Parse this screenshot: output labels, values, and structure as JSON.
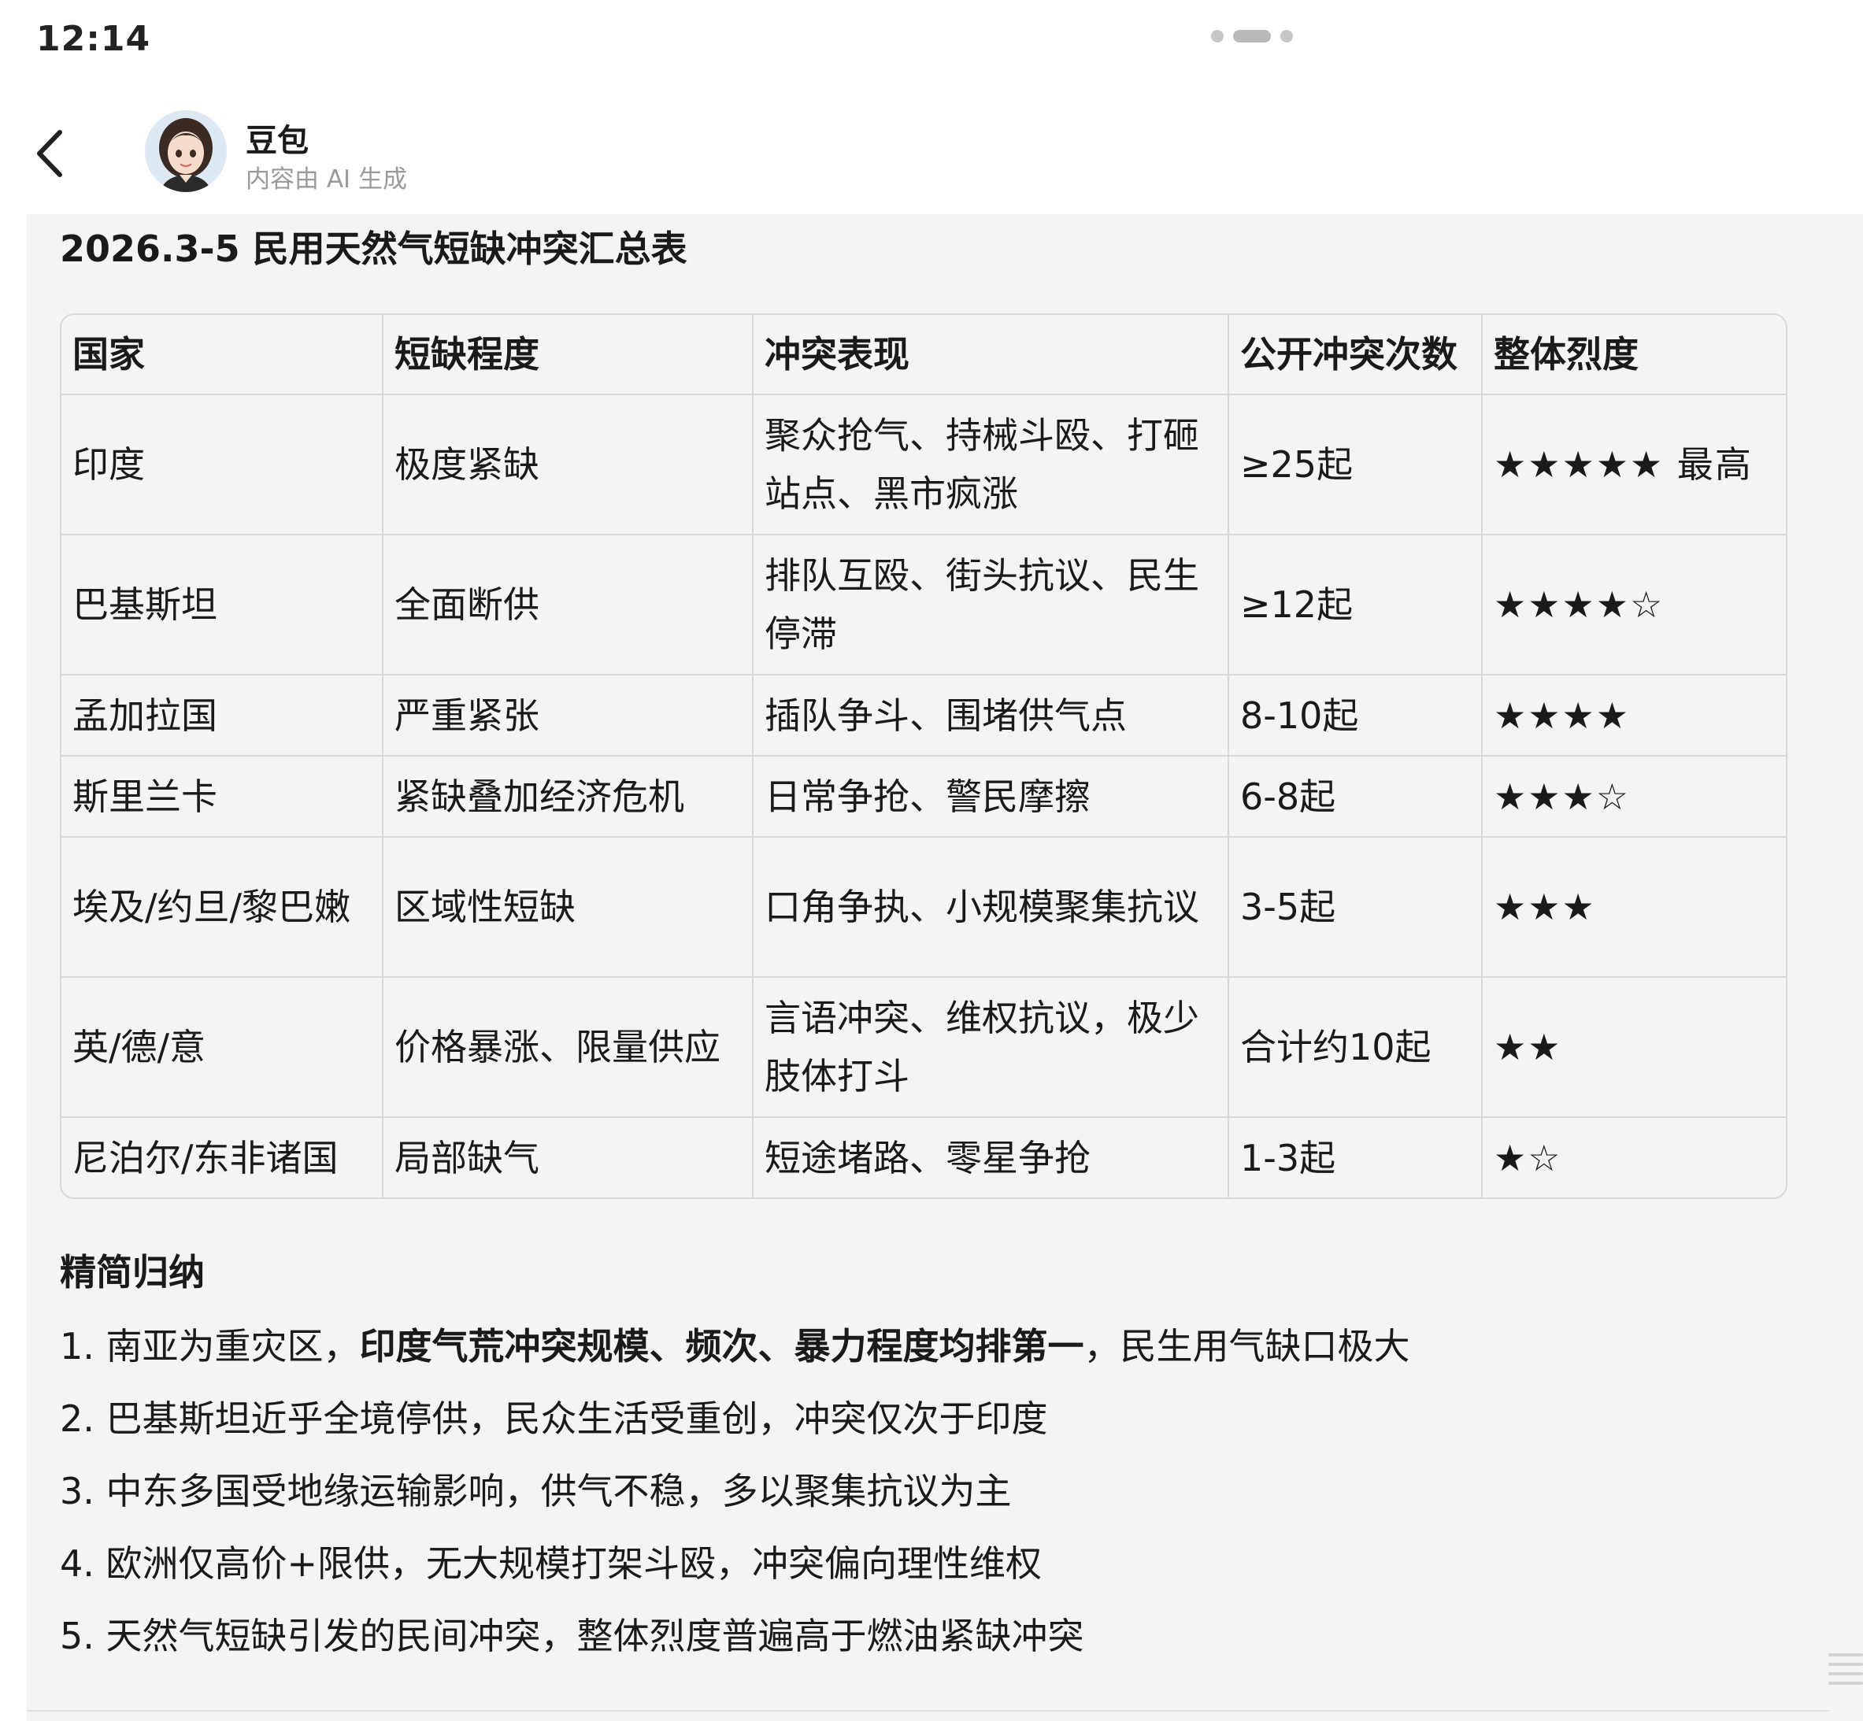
{
  "status_bar": {
    "time": "12:14"
  },
  "header": {
    "bot_name": "豆包",
    "subtitle": "内容由 AI 生成"
  },
  "table_title": "2026.3-5 民用天然气短缺冲突汇总表",
  "table": {
    "headers": [
      "国家",
      "短缺程度",
      "冲突表现",
      "公开冲突次数",
      "整体烈度"
    ],
    "rows": [
      {
        "country": "印度",
        "severity": "极度紧缺",
        "behavior": "聚众抢气、持械斗殴、打砸站点、黑市疯涨",
        "count": "≥25起",
        "intensity": "★★★★★ 最高"
      },
      {
        "country": "巴基斯坦",
        "severity": "全面断供",
        "behavior": "排队互殴、街头抗议、民生停滞",
        "count": "≥12起",
        "intensity": "★★★★☆"
      },
      {
        "country": "孟加拉国",
        "severity": "严重紧张",
        "behavior": "插队争斗、围堵供气点",
        "count": "8-10起",
        "intensity": "★★★★"
      },
      {
        "country": "斯里兰卡",
        "severity": "紧缺叠加经济危机",
        "behavior": "日常争抢、警民摩擦",
        "count": "6-8起",
        "intensity": "★★★☆"
      },
      {
        "country": "埃及/约旦/黎巴嫩",
        "severity": "区域性短缺",
        "behavior": "口角争执、小规模聚集抗议",
        "count": "3-5起",
        "intensity": "★★★"
      },
      {
        "country": "英/德/意",
        "severity": "价格暴涨、限量供应",
        "behavior": "言语冲突、维权抗议，极少肢体打斗",
        "count": "合计约10起",
        "intensity": "★★"
      },
      {
        "country": "尼泊尔/东非诸国",
        "severity": "局部缺气",
        "behavior": "短途堵路、零星争抢",
        "count": "1-3起",
        "intensity": "★☆"
      }
    ]
  },
  "summary": {
    "title": "精简归纳",
    "items": [
      {
        "pre": "1. 南亚为重灾区，",
        "bold": "印度气荒冲突规模、频次、暴力程度均排第一",
        "post": "，民生用气缺口极大"
      },
      {
        "pre": "2. 巴基斯坦近乎全境停供，民众生活受重创，冲突仅次于印度",
        "bold": "",
        "post": ""
      },
      {
        "pre": "3. 中东多国受地缘运输影响，供气不稳，多以聚集抗议为主",
        "bold": "",
        "post": ""
      },
      {
        "pre": "4. 欧洲仅高价+限供，无大规模打架斗殴，冲突偏向理性维权",
        "bold": "",
        "post": ""
      },
      {
        "pre": "5. 天然气短缺引发的民间冲突，整体烈度普遍高于燃油紧缺冲突",
        "bold": "",
        "post": ""
      }
    ]
  },
  "icons": {
    "back": "chevron-left-icon",
    "avatar": "bot-avatar",
    "scroll": "scroll-lines-icon"
  }
}
